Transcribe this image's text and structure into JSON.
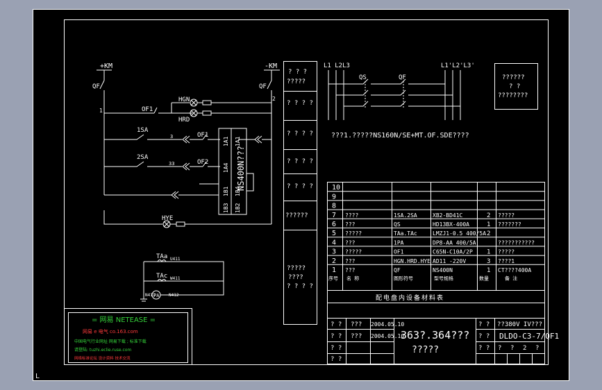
{
  "top_left": {
    "km_plus": "+KM",
    "km_minus": "-KM",
    "qf_left": "QF",
    "qf_right": "QF",
    "node1": "1",
    "node2": "2",
    "hgn": "HGN",
    "hrd": "HRD",
    "of1_a": "OF1",
    "sa1": "1SA",
    "n3": "3",
    "of1_b": "OF1",
    "sa2": "2SA",
    "n33": "33",
    "of2": "OF2",
    "breaker": "NS400N???",
    "terms_right": [
      "1A1",
      "1A4"
    ],
    "terms_left": [
      "1B1",
      "1B4"
    ],
    "terms_bot": [
      "1B3",
      "1B2",
      "1B3"
    ],
    "hye": "HYE",
    "taa": "TAa",
    "tac": "TAc",
    "u411": "U411",
    "w411": "W411",
    "n411": "N411",
    "n412": "N412",
    "pa": "PA"
  },
  "mid_column": [
    "? ? ?\n?????",
    "? ? ? ?",
    "? ? ? ?",
    "? ? ? ?",
    "? ? ? ?",
    "??????",
    "?????\n????\n? ? ? ?"
  ],
  "three_phase": {
    "l_in": "L1 L2L3",
    "l_out": "L1'L2'L3'",
    "qs": "QS",
    "qf": "QF",
    "note": "???1.?????NS160N/SE+MT.OF.SDE????"
  },
  "note_box": [
    "??????",
    "?  ?",
    "????????"
  ],
  "bom": {
    "rows": [
      {
        "no": "10",
        "name": "",
        "code": "",
        "model": "",
        "qty": "",
        "remark": ""
      },
      {
        "no": "9",
        "name": "",
        "code": "",
        "model": "",
        "qty": "",
        "remark": ""
      },
      {
        "no": "8",
        "name": "",
        "code": "",
        "model": "",
        "qty": "",
        "remark": ""
      },
      {
        "no": "7",
        "name": "????",
        "code": "1SA.2SA",
        "model": "XB2-BD41C",
        "qty": "2",
        "remark": "?????"
      },
      {
        "no": "6",
        "name": "???",
        "code": "QS",
        "model": "HD13BX-400A",
        "qty": "1",
        "remark": "???????"
      },
      {
        "no": "5",
        "name": "?????",
        "code": "TAa.TAc",
        "model": "LMZJ1-0.5 400/5A",
        "qty": "2",
        "remark": ""
      },
      {
        "no": "4",
        "name": "???",
        "code": "1PA",
        "model": "DP8-AA 400/5A",
        "qty": "",
        "remark": "???????????"
      },
      {
        "no": "3",
        "name": "?????",
        "code": "OF1",
        "model": "C65N-C10A/2P",
        "qty": "1",
        "remark": "?????"
      },
      {
        "no": "2",
        "name": "???",
        "code": "HGN.HRD.HYE",
        "model": "AD11 -220V",
        "qty": "3",
        "remark": "????1"
      },
      {
        "no": "1",
        "name": "???",
        "code": "QF",
        "model": "NS400N",
        "qty": "1",
        "remark": "CT????400A"
      }
    ],
    "header": [
      "序号",
      "名 称",
      "图形符号",
      "型号规格",
      "数量",
      "备 注"
    ],
    "title": "配电盘内设备材料表"
  },
  "title_block": {
    "r1": [
      "? ?",
      "???",
      "2004.05.10"
    ],
    "r2": [
      "? ?",
      "???",
      "2004.05.10"
    ],
    "r3": [
      "? ?"
    ],
    "r4": [
      "? ?"
    ],
    "big1": "363?.364???",
    "big2": "?????",
    "right1": "??380V IV???",
    "right2": "DLDO-C3-7/QF1",
    "right3": [
      "?",
      "?",
      "2",
      "?"
    ]
  },
  "netease": {
    "title": "= 网易  NETEASE =",
    "line2": "网易 e 电气   co.163.com",
    "line3": "中国电气行业网址 网易下载 ; 标准下载",
    "line4": "请登陆: tuzhi.eclie.ruse.com",
    "line5": "网络标准论坛 设计资料 技术交流"
  },
  "colors": {
    "background": "#000000",
    "line": "#ffffff",
    "frame": "#9aa1b3",
    "netease_green": "#35d23a",
    "netease_red": "#ff3b3b"
  }
}
